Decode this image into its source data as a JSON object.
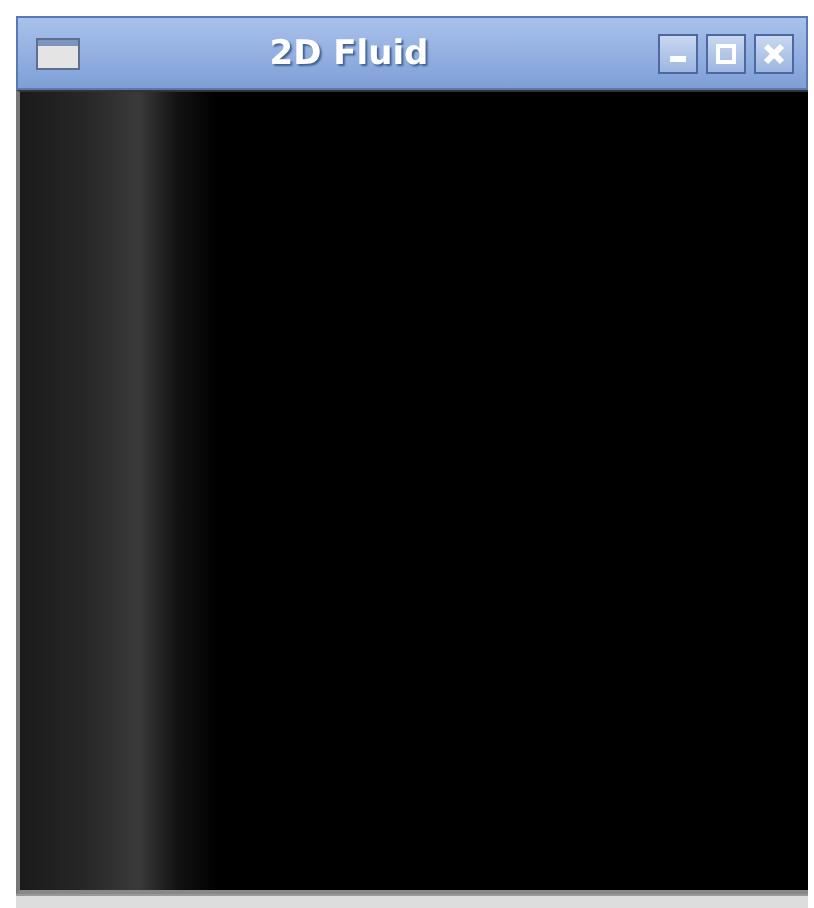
{
  "window": {
    "title": "2D Fluid"
  }
}
